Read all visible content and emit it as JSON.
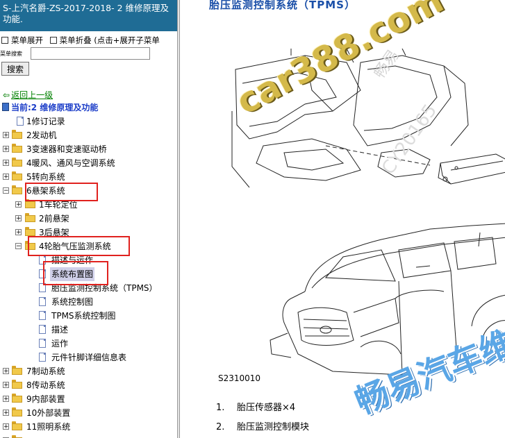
{
  "sidebar": {
    "title": "S-上汽名爵-ZS-2017-2018- 2 维修原理及功能.",
    "menu_expand": "菜单展开",
    "menu_collapse": "菜单折叠 (点击+展开子菜单",
    "search_label": "菜单搜索",
    "search_value": "",
    "search_button": "搜索",
    "back_link": "返回上一级",
    "current": "当前:2 维修原理及功能",
    "tree": [
      {
        "label": "1修订记录",
        "type": "doc"
      },
      {
        "label": "2发动机",
        "type": "folder"
      },
      {
        "label": "3变速器和变速驱动桥",
        "type": "folder"
      },
      {
        "label": "4暖风、通风与空调系统",
        "type": "folder"
      },
      {
        "label": "5转向系统",
        "type": "folder"
      },
      {
        "label": "6悬架系统",
        "type": "folder"
      },
      {
        "label": "1车轮定位",
        "type": "folder"
      },
      {
        "label": "2前悬架",
        "type": "folder"
      },
      {
        "label": "3后悬架",
        "type": "folder"
      },
      {
        "label": "4轮胎气压监测系统",
        "type": "folder"
      },
      {
        "label": "描述与运作",
        "type": "doc"
      },
      {
        "label": "系统布置图",
        "type": "doc"
      },
      {
        "label": "胎压监测控制系统（TPMS）",
        "type": "doc"
      },
      {
        "label": "系统控制图",
        "type": "doc"
      },
      {
        "label": "TPMS系统控制图",
        "type": "doc"
      },
      {
        "label": "描述",
        "type": "doc"
      },
      {
        "label": "运作",
        "type": "doc"
      },
      {
        "label": "元件针脚详细信息表",
        "type": "doc"
      },
      {
        "label": "7制动系统",
        "type": "folder"
      },
      {
        "label": "8传动系统",
        "type": "folder"
      },
      {
        "label": "9内部装置",
        "type": "folder"
      },
      {
        "label": "10外部装置",
        "type": "folder"
      },
      {
        "label": "11照明系统",
        "type": "folder"
      }
    ]
  },
  "content": {
    "title": "胎压监测控制系统（TPMS）",
    "figure_code": "S2310010",
    "legend": [
      {
        "num": "1.",
        "text": "胎压传感器×4"
      },
      {
        "num": "2.",
        "text": "胎压监测控制模块"
      }
    ]
  },
  "watermarks": {
    "site": "car388.com",
    "brand": "畅易汽车维",
    "faint": "畅易",
    "faint_code": "CY20165"
  },
  "colors": {
    "title_bar": "#1f6c95",
    "highlight_box": "#e0211e",
    "link_green": "#008000",
    "current_blue": "#1a3cc8"
  }
}
